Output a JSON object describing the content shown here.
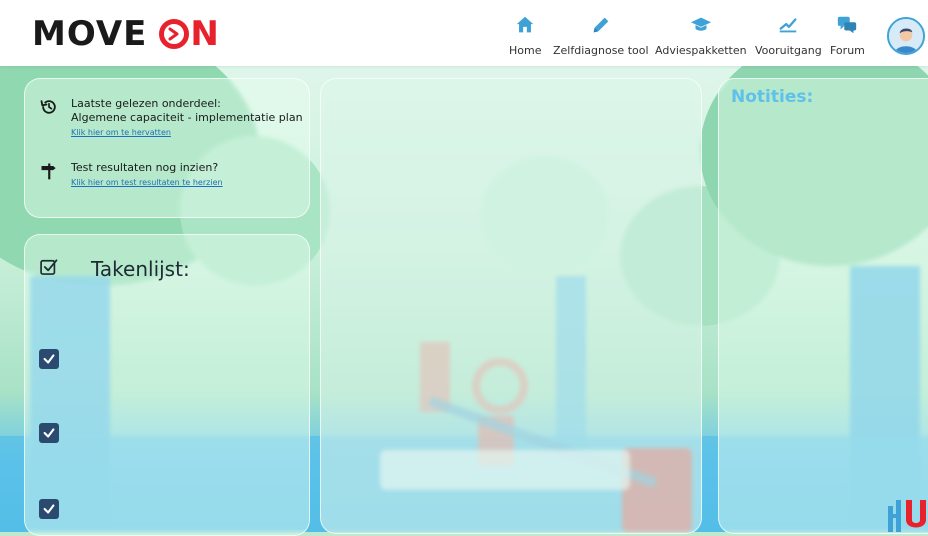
{
  "brand": {
    "word1": "MOVE",
    "word2": "N"
  },
  "nav": [
    {
      "label": "Home",
      "icon": "home-icon"
    },
    {
      "label": "Zelfdiagnose tool",
      "icon": "pencil-icon"
    },
    {
      "label": "Adviespakketten",
      "icon": "graduation-cap-icon"
    },
    {
      "label": "Vooruitgang",
      "icon": "chart-line-icon"
    },
    {
      "label": "Forum",
      "icon": "chat-bubbles-icon"
    }
  ],
  "recent": {
    "last_read_label": "Laatste gelezen onderdeel:",
    "last_read_item": "Algemene capaciteit - implementatie plan",
    "resume_link": "Klik hier om te hervatten",
    "test_label": "Test resultaten nog inzien?",
    "test_link": "Klik hier om test resultaten te herzien"
  },
  "tasks": {
    "title": "Takenlijst:",
    "items": [
      {
        "checked": true
      },
      {
        "checked": true
      },
      {
        "checked": true
      }
    ]
  },
  "notes": {
    "title": "Notities:"
  },
  "colors": {
    "brand_red": "#e8222d",
    "nav_icon": "#3ea2d6",
    "notes_title": "#5fc0e9",
    "checkbox": "#2b4a6f"
  }
}
